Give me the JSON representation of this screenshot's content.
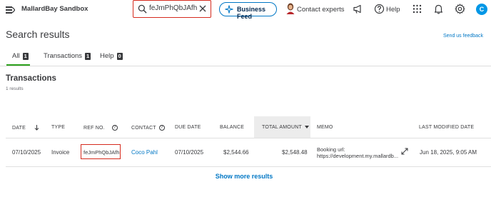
{
  "header": {
    "company_name": "MallardBay Sandbox",
    "search": {
      "value": "feJmPhQbJAfh"
    },
    "business_feed_label": "Business Feed",
    "contact_experts_label": "Contact experts",
    "help_label": "Help",
    "avatar_initial": "C"
  },
  "page": {
    "title": "Search results",
    "feedback_link": "Send us feedback"
  },
  "tabs": [
    {
      "label": "All",
      "count": "1",
      "active": true
    },
    {
      "label": "Transactions",
      "count": "1",
      "active": false
    },
    {
      "label": "Help",
      "count": "0",
      "active": false
    }
  ],
  "transactions": {
    "title": "Transactions",
    "count_text": "1 results",
    "columns": {
      "date": "DATE",
      "type": "TYPE",
      "ref_no": "REF NO.",
      "contact": "CONTACT",
      "due_date": "DUE DATE",
      "balance": "BALANCE",
      "total_amount": "TOTAL AMOUNT",
      "memo": "MEMO",
      "last_modified": "LAST MODIFIED DATE"
    },
    "rows": [
      {
        "date": "07/10/2025",
        "type": "Invoice",
        "ref_no": "feJmPhQbJAfh",
        "contact": "Coco Pahl",
        "due_date": "07/10/2025",
        "balance": "$2,544.66",
        "total_amount": "$2,548.48",
        "memo_line1": "Booking url:",
        "memo_line2": "https://development.my.mallardb...",
        "last_modified": "Jun 18, 2025, 9:05 AM"
      }
    ],
    "show_more_label": "Show more results"
  },
  "colors": {
    "accent_blue": "#0077c5",
    "active_tab_green": "#2ca01c",
    "highlight_red": "#d52b1e",
    "avatar_bg": "#0097e6"
  },
  "icons": [
    "menu-icon",
    "search-icon",
    "close-icon",
    "sparkle-icon",
    "megaphone-icon",
    "help-icon",
    "apps-grid-icon",
    "bell-icon",
    "gear-icon",
    "sort-down-icon",
    "expand-icon"
  ]
}
